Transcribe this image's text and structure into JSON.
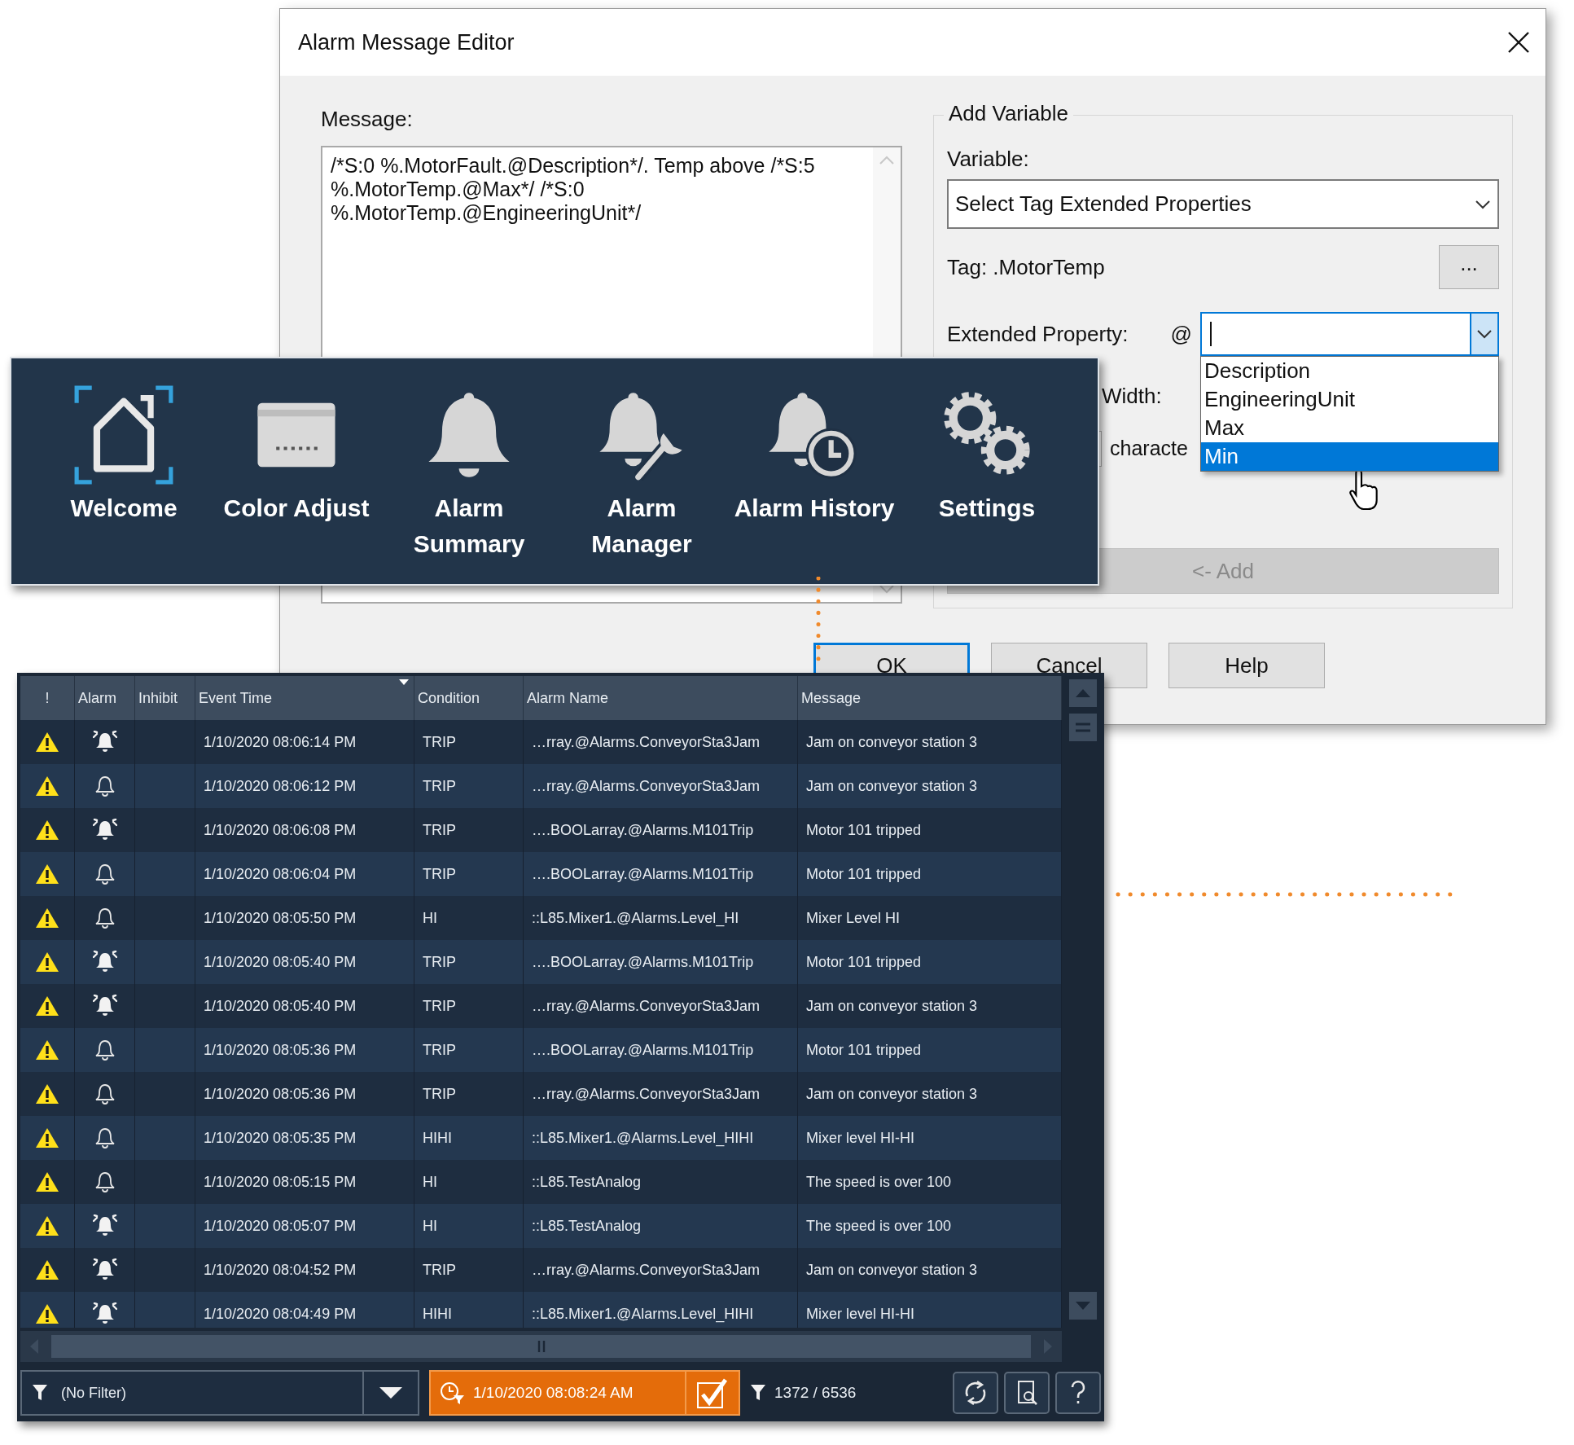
{
  "dialog": {
    "title": "Alarm Message Editor",
    "message_label": "Message:",
    "message_value": "/*S:0 %.MotorFault.@Description*/. Temp above /*S:5 %.MotorTemp.@Max*/ /*S:0 %.MotorTemp.@EngineeringUnit*/",
    "group_title": "Add Variable",
    "variable_label": "Variable:",
    "variable_value": "Select Tag Extended Properties",
    "tag_label": "Tag: .MotorTemp",
    "browse_button": "...",
    "extended_property_label": "Extended Property:",
    "at_sign": "@",
    "property_options": [
      {
        "label": "Description",
        "selected": false
      },
      {
        "label": "EngineeringUnit",
        "selected": false
      },
      {
        "label": "Max",
        "selected": false
      },
      {
        "label": "Min",
        "selected": true
      }
    ],
    "width_label": "Width:",
    "characters_label": "characte",
    "add_button": "<- Add",
    "add_disabled": true,
    "buttons": [
      {
        "label": "OK",
        "default": true
      },
      {
        "label": "Cancel",
        "default": false
      },
      {
        "label": "Help",
        "default": false
      }
    ]
  },
  "nav": {
    "items": [
      {
        "label": "Welcome",
        "kind": "home",
        "selected": true
      },
      {
        "label": "Color Adjust",
        "kind": "display",
        "selected": false
      },
      {
        "label": "Alarm Summary",
        "kind": "bell",
        "selected": false
      },
      {
        "label": "Alarm Manager",
        "kind": "bell-wrench",
        "selected": false
      },
      {
        "label": "Alarm History",
        "kind": "bell-clock",
        "selected": false
      },
      {
        "label": "Settings",
        "kind": "gears",
        "selected": false
      }
    ]
  },
  "table": {
    "columns": [
      {
        "label": "!",
        "sorted": false
      },
      {
        "label": "Alarm",
        "sorted": false
      },
      {
        "label": "Inhibit",
        "sorted": false
      },
      {
        "label": "Event Time",
        "sorted": true
      },
      {
        "label": "Condition",
        "sorted": false
      },
      {
        "label": "Alarm Name",
        "sorted": false
      },
      {
        "label": "Message",
        "sorted": false
      }
    ],
    "rows": [
      {
        "ringing": true,
        "event_time": "1/10/2020 08:06:14 PM",
        "condition": "TRIP",
        "alarm_name": "…rray.@Alarms.ConveyorSta3Jam",
        "message": "Jam on conveyor station 3"
      },
      {
        "ringing": false,
        "event_time": "1/10/2020 08:06:12 PM",
        "condition": "TRIP",
        "alarm_name": "…rray.@Alarms.ConveyorSta3Jam",
        "message": "Jam on conveyor station 3"
      },
      {
        "ringing": true,
        "event_time": "1/10/2020 08:06:08 PM",
        "condition": "TRIP",
        "alarm_name": "….BOOLarray.@Alarms.M101Trip",
        "message": "Motor 101 tripped"
      },
      {
        "ringing": false,
        "event_time": "1/10/2020 08:06:04 PM",
        "condition": "TRIP",
        "alarm_name": "….BOOLarray.@Alarms.M101Trip",
        "message": "Motor 101 tripped"
      },
      {
        "ringing": false,
        "event_time": "1/10/2020 08:05:50 PM",
        "condition": "HI",
        "alarm_name": "::L85.Mixer1.@Alarms.Level_HI",
        "message": "Mixer Level HI"
      },
      {
        "ringing": true,
        "event_time": "1/10/2020 08:05:40 PM",
        "condition": "TRIP",
        "alarm_name": "….BOOLarray.@Alarms.M101Trip",
        "message": "Motor 101 tripped"
      },
      {
        "ringing": true,
        "event_time": "1/10/2020 08:05:40 PM",
        "condition": "TRIP",
        "alarm_name": "…rray.@Alarms.ConveyorSta3Jam",
        "message": "Jam on conveyor station 3"
      },
      {
        "ringing": false,
        "event_time": "1/10/2020 08:05:36 PM",
        "condition": "TRIP",
        "alarm_name": "….BOOLarray.@Alarms.M101Trip",
        "message": "Motor 101 tripped"
      },
      {
        "ringing": false,
        "event_time": "1/10/2020 08:05:36 PM",
        "condition": "TRIP",
        "alarm_name": "…rray.@Alarms.ConveyorSta3Jam",
        "message": "Jam on conveyor station 3"
      },
      {
        "ringing": false,
        "event_time": "1/10/2020 08:05:35 PM",
        "condition": "HIHI",
        "alarm_name": "::L85.Mixer1.@Alarms.Level_HIHI",
        "message": "Mixer level HI-HI"
      },
      {
        "ringing": false,
        "event_time": "1/10/2020 08:05:15 PM",
        "condition": "HI",
        "alarm_name": "::L85.TestAnalog",
        "message": "The speed is over 100"
      },
      {
        "ringing": true,
        "event_time": "1/10/2020 08:05:07 PM",
        "condition": "HI",
        "alarm_name": "::L85.TestAnalog",
        "message": "The speed is over 100"
      },
      {
        "ringing": true,
        "event_time": "1/10/2020 08:04:52 PM",
        "condition": "TRIP",
        "alarm_name": "…rray.@Alarms.ConveyorSta3Jam",
        "message": "Jam on conveyor station 3"
      },
      {
        "ringing": true,
        "event_time": "1/10/2020 08:04:49 PM",
        "condition": "HIHI",
        "alarm_name": "::L85.Mixer1.@Alarms.Level_HIHI",
        "message": "Mixer level HI-HI"
      }
    ]
  },
  "footer": {
    "filter": "(No Filter)",
    "time": "1/10/2020 08:08:24 AM",
    "time_checked": true,
    "count": "1372 / 6536"
  }
}
